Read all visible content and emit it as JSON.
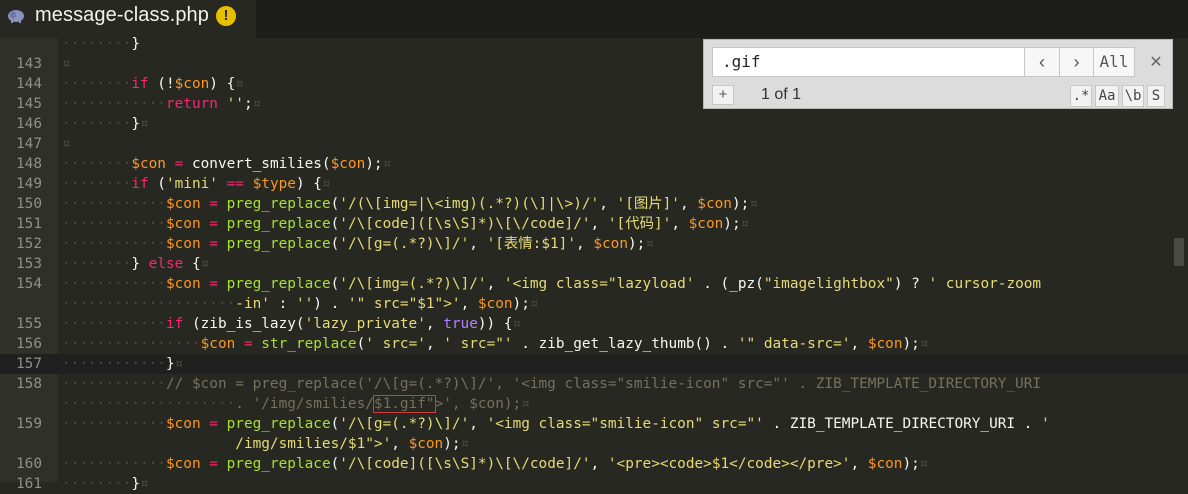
{
  "tab": {
    "filename": "message-class.php",
    "warning_glyph": "!"
  },
  "search": {
    "query": ".gif",
    "prev_glyph": "‹",
    "next_glyph": "›",
    "all_label": "All",
    "close_glyph": "✕",
    "add_glyph": "+",
    "match_count": "1 of 1",
    "regex_label": ".*",
    "case_label": "Aa",
    "word_label": "\\b",
    "selection_label": "S"
  },
  "colors": {
    "background": "#272822",
    "keyword": "#f92672",
    "variable": "#fd971f",
    "string": "#e6db74",
    "function": "#a6e22e"
  },
  "lines": [
    {
      "num": "",
      "tokens": [
        [
          "ws",
          "········"
        ],
        [
          "pl",
          "}"
        ]
      ]
    },
    {
      "num": "143",
      "tokens": [
        [
          "ws",
          "¤"
        ]
      ]
    },
    {
      "num": "144",
      "tokens": [
        [
          "ws",
          "········"
        ],
        [
          "kw",
          "if"
        ],
        [
          "pl",
          " (!"
        ],
        [
          "var",
          "$con"
        ],
        [
          "pl",
          ") {"
        ],
        [
          "ws",
          "¤"
        ]
      ]
    },
    {
      "num": "145",
      "tokens": [
        [
          "ws",
          "············"
        ],
        [
          "kw",
          "return"
        ],
        [
          "pl",
          " "
        ],
        [
          "str",
          "''"
        ],
        [
          "pl",
          ";"
        ],
        [
          "ws",
          "¤"
        ]
      ]
    },
    {
      "num": "146",
      "tokens": [
        [
          "ws",
          "········"
        ],
        [
          "pl",
          "}"
        ],
        [
          "ws",
          "¤"
        ]
      ]
    },
    {
      "num": "147",
      "tokens": [
        [
          "ws",
          "¤"
        ]
      ]
    },
    {
      "num": "148",
      "tokens": [
        [
          "ws",
          "········"
        ],
        [
          "var",
          "$con"
        ],
        [
          "pl",
          " "
        ],
        [
          "op",
          "="
        ],
        [
          "pl",
          " convert_smilies("
        ],
        [
          "var",
          "$con"
        ],
        [
          "pl",
          ");"
        ],
        [
          "ws",
          "¤"
        ]
      ]
    },
    {
      "num": "149",
      "tokens": [
        [
          "ws",
          "········"
        ],
        [
          "kw",
          "if"
        ],
        [
          "pl",
          " ("
        ],
        [
          "str",
          "'mini'"
        ],
        [
          "pl",
          " "
        ],
        [
          "op",
          "=="
        ],
        [
          "pl",
          " "
        ],
        [
          "var",
          "$type"
        ],
        [
          "pl",
          ") {"
        ],
        [
          "ws",
          "¤"
        ]
      ]
    },
    {
      "num": "150",
      "tokens": [
        [
          "ws",
          "············"
        ],
        [
          "var",
          "$con"
        ],
        [
          "pl",
          " "
        ],
        [
          "op",
          "="
        ],
        [
          "pl",
          " "
        ],
        [
          "fn",
          "preg_replace"
        ],
        [
          "pl",
          "("
        ],
        [
          "str",
          "'/(\\[img=|\\<img)(.*?)(\\]|\\>)/'"
        ],
        [
          "pl",
          ", "
        ],
        [
          "str",
          "'[图片]'"
        ],
        [
          "pl",
          ", "
        ],
        [
          "var",
          "$con"
        ],
        [
          "pl",
          ");"
        ],
        [
          "ws",
          "¤"
        ]
      ]
    },
    {
      "num": "151",
      "tokens": [
        [
          "ws",
          "············"
        ],
        [
          "var",
          "$con"
        ],
        [
          "pl",
          " "
        ],
        [
          "op",
          "="
        ],
        [
          "pl",
          " "
        ],
        [
          "fn",
          "preg_replace"
        ],
        [
          "pl",
          "("
        ],
        [
          "str",
          "'/\\[code]([\\s\\S]*)\\[\\/code]/'"
        ],
        [
          "pl",
          ", "
        ],
        [
          "str",
          "'[代码]'"
        ],
        [
          "pl",
          ", "
        ],
        [
          "var",
          "$con"
        ],
        [
          "pl",
          ");"
        ],
        [
          "ws",
          "¤"
        ]
      ]
    },
    {
      "num": "152",
      "tokens": [
        [
          "ws",
          "············"
        ],
        [
          "var",
          "$con"
        ],
        [
          "pl",
          " "
        ],
        [
          "op",
          "="
        ],
        [
          "pl",
          " "
        ],
        [
          "fn",
          "preg_replace"
        ],
        [
          "pl",
          "("
        ],
        [
          "str",
          "'/\\[g=(.*?)\\]/'"
        ],
        [
          "pl",
          ", "
        ],
        [
          "str",
          "'[表情:$1]'"
        ],
        [
          "pl",
          ", "
        ],
        [
          "var",
          "$con"
        ],
        [
          "pl",
          ");"
        ],
        [
          "ws",
          "¤"
        ]
      ]
    },
    {
      "num": "153",
      "tokens": [
        [
          "ws",
          "········"
        ],
        [
          "pl",
          "} "
        ],
        [
          "kw",
          "else"
        ],
        [
          "pl",
          " {"
        ],
        [
          "ws",
          "¤"
        ]
      ]
    },
    {
      "num": "154",
      "tokens": [
        [
          "ws",
          "············"
        ],
        [
          "var",
          "$con"
        ],
        [
          "pl",
          " "
        ],
        [
          "op",
          "="
        ],
        [
          "pl",
          " "
        ],
        [
          "fn",
          "preg_replace"
        ],
        [
          "pl",
          "("
        ],
        [
          "str",
          "'/\\[img=(.*?)\\]/'"
        ],
        [
          "pl",
          ", "
        ],
        [
          "str",
          "'<img class=\"lazyload' "
        ],
        [
          "pl",
          ". (_pz("
        ],
        [
          "str",
          "\"imagelightbox\""
        ],
        [
          "pl",
          ") ? "
        ],
        [
          "str",
          "' cursor-zoom"
        ]
      ]
    },
    {
      "num": "",
      "tokens": [
        [
          "ws",
          "····················"
        ],
        [
          "str",
          "-in' "
        ],
        [
          "pl",
          ": "
        ],
        [
          "str",
          "''"
        ],
        [
          "pl",
          ") . "
        ],
        [
          "str",
          "'\" src=\"$1\">'"
        ],
        [
          "pl",
          ", "
        ],
        [
          "var",
          "$con"
        ],
        [
          "pl",
          ");"
        ],
        [
          "ws",
          "¤"
        ]
      ]
    },
    {
      "num": "155",
      "tokens": [
        [
          "ws",
          "············"
        ],
        [
          "kw",
          "if"
        ],
        [
          "pl",
          " (zib_is_lazy("
        ],
        [
          "str",
          "'lazy_private'"
        ],
        [
          "pl",
          ", "
        ],
        [
          "con",
          "true"
        ],
        [
          "pl",
          ")) {"
        ],
        [
          "ws",
          "¤"
        ]
      ]
    },
    {
      "num": "156",
      "tokens": [
        [
          "ws",
          "················"
        ],
        [
          "var",
          "$con"
        ],
        [
          "pl",
          " "
        ],
        [
          "op",
          "="
        ],
        [
          "pl",
          " "
        ],
        [
          "fn",
          "str_replace"
        ],
        [
          "pl",
          "("
        ],
        [
          "str",
          "' src='"
        ],
        [
          "pl",
          ", "
        ],
        [
          "str",
          "' src=\"' "
        ],
        [
          "pl",
          ". zib_get_lazy_thumb() . "
        ],
        [
          "str",
          "'\" data-src='"
        ],
        [
          "pl",
          ", "
        ],
        [
          "var",
          "$con"
        ],
        [
          "pl",
          ");"
        ],
        [
          "ws",
          "¤"
        ]
      ]
    },
    {
      "num": "157",
      "tokens": [
        [
          "ws",
          "············"
        ],
        [
          "pl",
          "}"
        ],
        [
          "ws",
          "¤"
        ]
      ]
    },
    {
      "num": "158",
      "tokens": [
        [
          "ws",
          "············"
        ],
        [
          "cm",
          "// $con = preg_replace('/\\[g=(.*?)\\]/', '<img class=\"smilie-icon\" src=\"' . ZIB_TEMPLATE_DIRECTORY_URI"
        ]
      ]
    },
    {
      "num": "",
      "tokens": [
        [
          "ws",
          "····················"
        ],
        [
          "cm",
          ". '/img/smilies/"
        ],
        [
          "hlcm",
          "$1.gif\""
        ],
        [
          "cm",
          ">', $con);"
        ],
        [
          "ws",
          "¤"
        ]
      ]
    },
    {
      "num": "159",
      "tokens": [
        [
          "ws",
          "············"
        ],
        [
          "var",
          "$con"
        ],
        [
          "pl",
          " "
        ],
        [
          "op",
          "="
        ],
        [
          "pl",
          " "
        ],
        [
          "fn",
          "preg_replace"
        ],
        [
          "pl",
          "("
        ],
        [
          "str",
          "'/\\[g=(.*?)\\]/'"
        ],
        [
          "pl",
          ", "
        ],
        [
          "str",
          "'<img class=\"smilie-icon\" src=\"' "
        ],
        [
          "pl",
          ". ZIB_TEMPLATE_DIRECTORY_URI . "
        ],
        [
          "str",
          "'"
        ]
      ]
    },
    {
      "num": "",
      "tokens": [
        [
          "str",
          "                    /img/smilies/$1\">'"
        ],
        [
          "pl",
          ", "
        ],
        [
          "var",
          "$con"
        ],
        [
          "pl",
          ");"
        ],
        [
          "ws",
          "¤"
        ]
      ]
    },
    {
      "num": "160",
      "tokens": [
        [
          "ws",
          "············"
        ],
        [
          "var",
          "$con"
        ],
        [
          "pl",
          " "
        ],
        [
          "op",
          "="
        ],
        [
          "pl",
          " "
        ],
        [
          "fn",
          "preg_replace"
        ],
        [
          "pl",
          "("
        ],
        [
          "str",
          "'/\\[code]([\\s\\S]*)\\[\\/code]/'"
        ],
        [
          "pl",
          ", "
        ],
        [
          "str",
          "'<pre><code>$1</code></pre>'"
        ],
        [
          "pl",
          ", "
        ],
        [
          "var",
          "$con"
        ],
        [
          "pl",
          ");"
        ],
        [
          "ws",
          "¤"
        ]
      ]
    },
    {
      "num": "161",
      "tokens": [
        [
          "ws",
          "········"
        ],
        [
          "pl",
          "}"
        ],
        [
          "ws",
          "¤"
        ]
      ]
    }
  ]
}
